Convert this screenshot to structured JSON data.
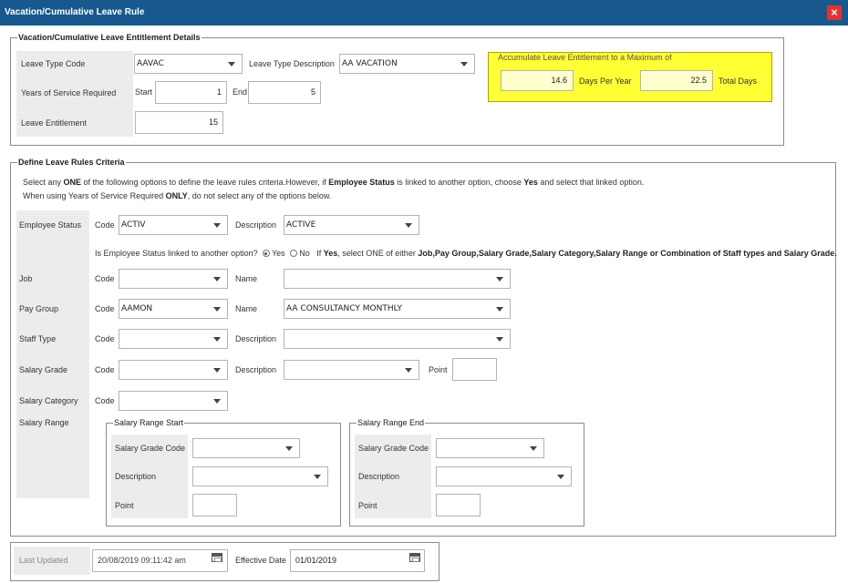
{
  "window": {
    "title": "Vacation/Cumulative Leave Rule",
    "close_label": "×"
  },
  "entitlement": {
    "legend": "Vacation/Cumulative Leave Entitlement Details",
    "leave_type_code_label": "Leave Type Code",
    "leave_type_code_value": "AAVAC",
    "leave_type_description_label": "Leave Type Description",
    "leave_type_description_value": "AA VACATION",
    "years_of_service_label": "Years of Service Required",
    "start_label": "Start",
    "start_value": "1",
    "end_label": "End",
    "end_value": "5",
    "leave_entitlement_label": "Leave Entitlement",
    "leave_entitlement_value": "15",
    "accumulate": {
      "legend": "Accumulate Leave Entitlement to a Maximum of",
      "days_per_year_value": "14.6",
      "days_per_year_label": "Days Per Year",
      "total_days_value": "22.5",
      "total_days_label": "Total Days",
      "highlight_color": "#ffff33"
    }
  },
  "criteria": {
    "legend": "Define Leave Rules Criteria",
    "instruction1_pre": "Select any ",
    "instruction1_one": "ONE",
    "instruction1_mid": " of the following options to define the leave rules criteria.However, if ",
    "instruction1_status": "Employee Status",
    "instruction1_mid2": " is linked to another option, choose ",
    "instruction1_yes": "Yes",
    "instruction1_post": " and select that linked option.",
    "instruction2_pre": "When using Years of Service Required ",
    "instruction2_only": "ONLY",
    "instruction2_post": ", do not select any of the options below.",
    "employee_status_label": "Employee Status",
    "code_label": "Code",
    "description_label": "Description",
    "name_label": "Name",
    "point_label": "Point",
    "employee_status_code": "ACTIV",
    "employee_status_description": "ACTIVE",
    "linked_question": "Is Employee Status linked to another option?",
    "yes_label": "Yes",
    "no_label": "No",
    "linked_note_pre": "If ",
    "linked_note_yes": "Yes",
    "linked_note_mid": ", select ONE of either ",
    "linked_note_list": "Job,Pay Group,Salary Grade,Salary Category,Salary Range or Combination of Staff types and Salary Grade.",
    "job_label": "Job",
    "job_code": "",
    "job_name": "",
    "pay_group_label": "Pay Group",
    "pay_group_code": "AAMON",
    "pay_group_name": "AA CONSULTANCY MONTHLY",
    "staff_type_label": "Staff Type",
    "staff_type_code": "",
    "staff_type_description": "",
    "salary_grade_label": "Salary Grade",
    "salary_grade_code": "",
    "salary_grade_description": "",
    "salary_grade_point": "",
    "salary_category_label": "Salary Category",
    "salary_category_code": "",
    "salary_range_label": "Salary Range",
    "range_start": {
      "legend": "Salary Range Start",
      "grade_code_label": "Salary Grade Code",
      "description_label": "Description",
      "point_label": "Point",
      "grade_code": "",
      "description": "",
      "point": ""
    },
    "range_end": {
      "legend": "Salary Range End",
      "grade_code_label": "Salary Grade Code",
      "description_label": "Description",
      "point_label": "Point",
      "grade_code": "",
      "description": "",
      "point": ""
    }
  },
  "footer": {
    "last_updated_label": "Last Updated",
    "last_updated_value": "20/08/2019 09:11:42 am",
    "effective_date_label": "Effective Date",
    "effective_date_value": "01/01/2019"
  }
}
